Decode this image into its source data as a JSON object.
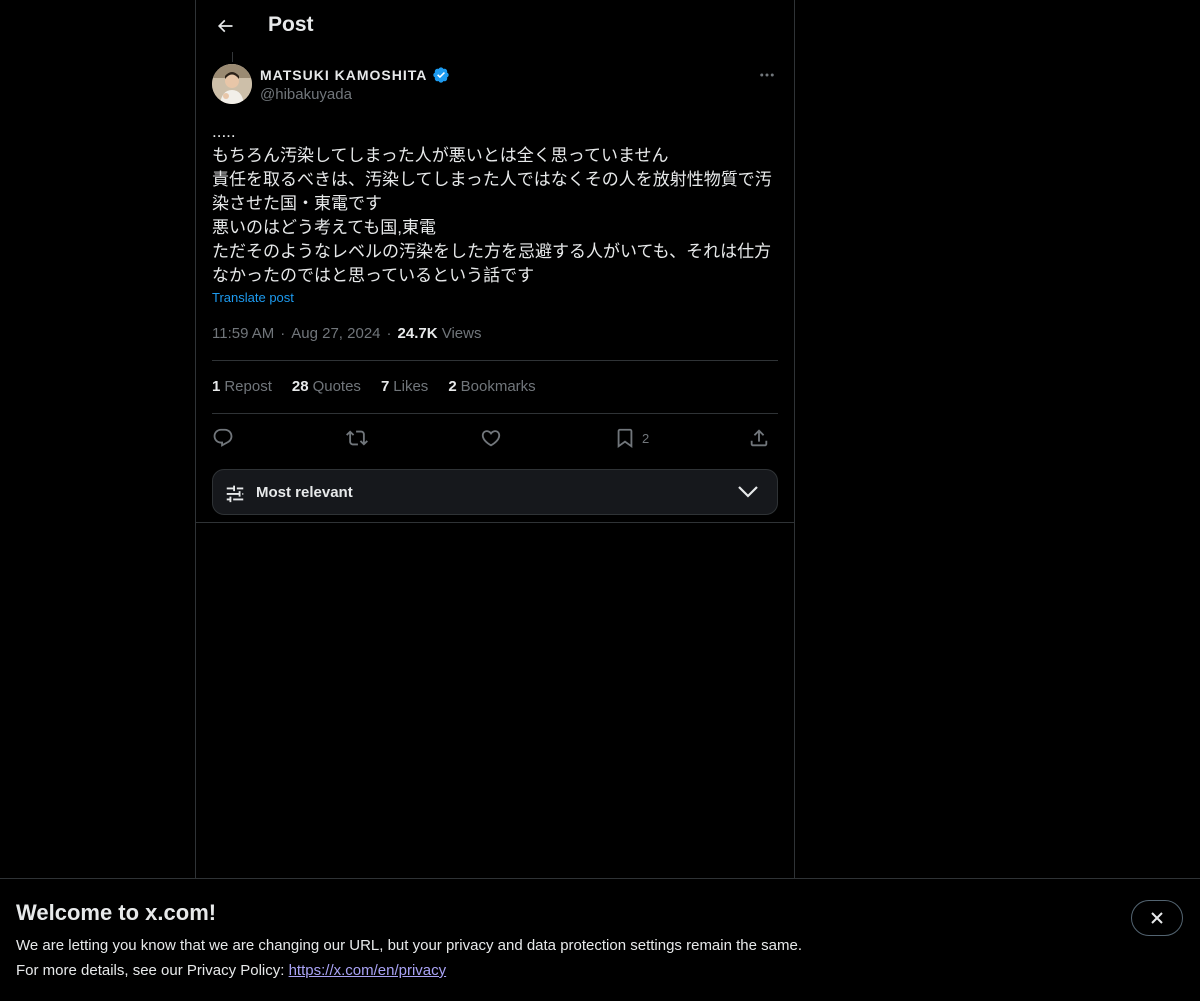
{
  "header": {
    "title": "Post",
    "back_icon": "arrow-left-icon"
  },
  "post": {
    "author": {
      "display_name": "MATSUKI KAMOSHITA",
      "handle": "@hibakuyada",
      "verified": true,
      "verified_color": "#1d9bf0"
    },
    "text_lines": [
      ".....",
      "もちろん汚染してしまった人が悪いとは全く思っていません",
      "責任を取るべきは、汚染してしまった人ではなくその人を放射性物質で汚染させた国・東電です",
      "悪いのはどう考えても国,東電",
      "ただそのようなレベルの汚染をした方を忌避する人がいても、それは仕方なかったのではと思っているという話です"
    ],
    "translate_label": "Translate post",
    "time": "11:59 AM",
    "date": "Aug 27, 2024",
    "views_count": "24.7K",
    "views_label": "Views",
    "separator": "·"
  },
  "stats": [
    {
      "count": "1",
      "label": "Repost"
    },
    {
      "count": "28",
      "label": "Quotes"
    },
    {
      "count": "7",
      "label": "Likes"
    },
    {
      "count": "2",
      "label": "Bookmarks"
    }
  ],
  "actions": {
    "reply_icon": "reply-icon",
    "repost_icon": "repost-icon",
    "like_icon": "heart-icon",
    "bookmark_icon": "bookmark-icon",
    "bookmark_count": "2",
    "share_icon": "share-icon"
  },
  "sort": {
    "label": "Most relevant",
    "icon": "sliders-icon"
  },
  "banner": {
    "title": "Welcome to x.com!",
    "line1": "We are letting you know that we are changing our URL, but your privacy and data protection settings remain the same.",
    "line2_prefix": "For more details, see our Privacy Policy: ",
    "link_text": "https://x.com/en/privacy",
    "link_color": "#a9a3f5"
  },
  "colors": {
    "background": "#000000",
    "text_primary": "#e7e9ea",
    "text_secondary": "#71767b",
    "accent": "#1d9bf0",
    "border": "#2f3336"
  }
}
